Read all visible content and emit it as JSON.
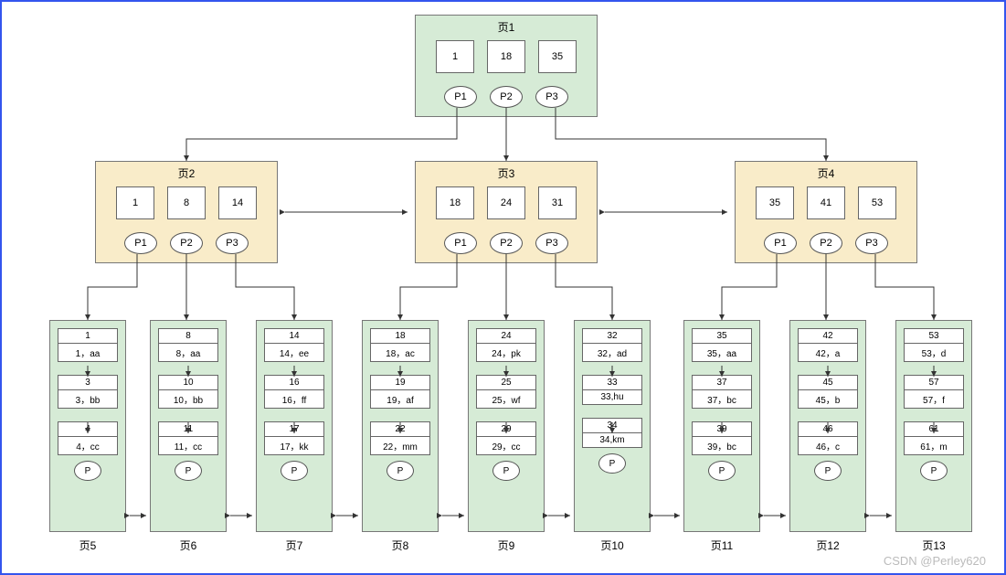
{
  "watermark": "CSDN @Perley620",
  "root": {
    "title": "页1",
    "keys": [
      "1",
      "18",
      "35"
    ],
    "ptrs": [
      "P1",
      "P2",
      "P3"
    ]
  },
  "mid": [
    {
      "title": "页2",
      "keys": [
        "1",
        "8",
        "14"
      ],
      "ptrs": [
        "P1",
        "P2",
        "P3"
      ]
    },
    {
      "title": "页3",
      "keys": [
        "18",
        "24",
        "31"
      ],
      "ptrs": [
        "P1",
        "P2",
        "P3"
      ]
    },
    {
      "title": "页4",
      "keys": [
        "35",
        "41",
        "53"
      ],
      "ptrs": [
        "P1",
        "P2",
        "P3"
      ]
    }
  ],
  "leaves": [
    {
      "label": "页5",
      "records": [
        {
          "k": "1",
          "v": "1，aa"
        },
        {
          "k": "3",
          "v": "3，bb"
        },
        {
          "k": "4",
          "v": "4，cc"
        }
      ]
    },
    {
      "label": "页6",
      "records": [
        {
          "k": "8",
          "v": "8，aa"
        },
        {
          "k": "10",
          "v": "10，bb"
        },
        {
          "k": "11",
          "v": "11，cc"
        }
      ]
    },
    {
      "label": "页7",
      "records": [
        {
          "k": "14",
          "v": "14，ee"
        },
        {
          "k": "16",
          "v": "16，ff"
        },
        {
          "k": "17",
          "v": "17，kk"
        }
      ]
    },
    {
      "label": "页8",
      "records": [
        {
          "k": "18",
          "v": "18，ac"
        },
        {
          "k": "19",
          "v": "19，af"
        },
        {
          "k": "22",
          "v": "22，mm"
        }
      ]
    },
    {
      "label": "页9",
      "records": [
        {
          "k": "24",
          "v": "24，pk"
        },
        {
          "k": "25",
          "v": "25，wf"
        },
        {
          "k": "29",
          "v": "29，cc"
        }
      ]
    },
    {
      "label": "页10",
      "records": [
        {
          "k": "32",
          "v": "32，ad"
        },
        {
          "k": "33",
          "v": "33,hu"
        },
        {
          "k": "34",
          "v": "34,km"
        }
      ]
    },
    {
      "label": "页11",
      "records": [
        {
          "k": "35",
          "v": "35，aa"
        },
        {
          "k": "37",
          "v": "37，bc"
        },
        {
          "k": "39",
          "v": "39，bc"
        }
      ]
    },
    {
      "label": "页12",
      "records": [
        {
          "k": "42",
          "v": "42，a"
        },
        {
          "k": "45",
          "v": "45，b"
        },
        {
          "k": "46",
          "v": "46，c"
        }
      ]
    },
    {
      "label": "页13",
      "records": [
        {
          "k": "53",
          "v": "53，d"
        },
        {
          "k": "57",
          "v": "57，f"
        },
        {
          "k": "61",
          "v": "61，m"
        }
      ]
    }
  ],
  "leaf_ptr_label": "P"
}
